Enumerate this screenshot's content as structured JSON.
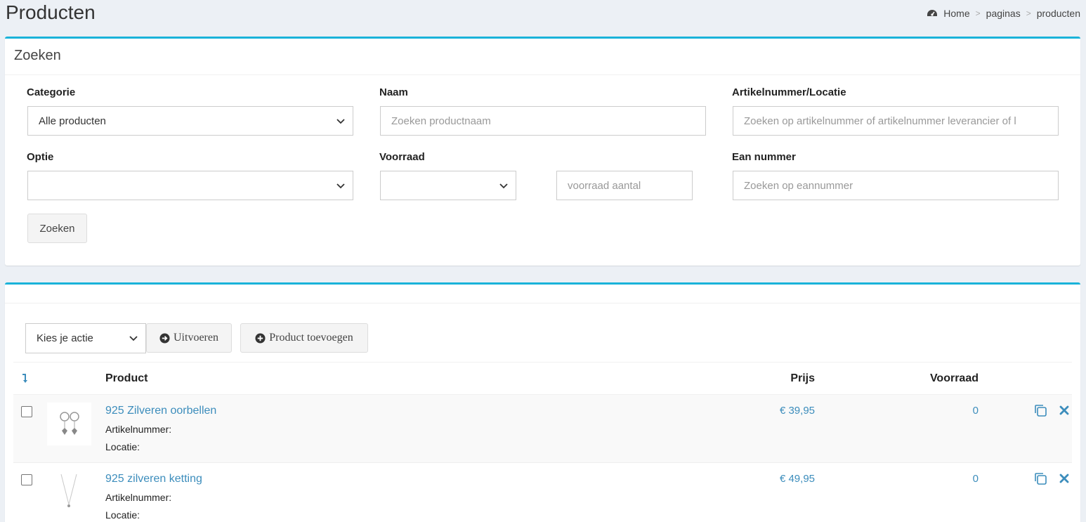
{
  "header": {
    "title": "Producten",
    "breadcrumb": [
      "Home",
      "paginas",
      "producten"
    ]
  },
  "search": {
    "title": "Zoeken",
    "categorie_label": "Categorie",
    "categorie_value": "Alle producten",
    "naam_label": "Naam",
    "naam_placeholder": "Zoeken productnaam",
    "artikel_label": "Artikelnummer/Locatie",
    "artikel_placeholder": "Zoeken op artikelnummer of artikelnummer leverancier of l",
    "optie_label": "Optie",
    "voorraad_label": "Voorraad",
    "voorraad_aantal_placeholder": "voorraad aantal",
    "ean_label": "Ean nummer",
    "ean_placeholder": "Zoeken op eannummer",
    "submit_label": "Zoeken"
  },
  "list": {
    "action_select": "Kies je actie",
    "execute_label": "Uitvoeren",
    "add_label": "Product toevoegen",
    "columns": {
      "product": "Product",
      "prijs": "Prijs",
      "voorraad": "Voorraad"
    },
    "rows": [
      {
        "name": "925 Zilveren oorbellen",
        "artikel": "Artikelnummer:",
        "locatie": "Locatie:",
        "price": "€ 39,95",
        "stock": "0"
      },
      {
        "name": "925 zilveren ketting",
        "artikel": "Artikelnummer:",
        "locatie": "Locatie:",
        "price": "€ 49,95",
        "stock": "0"
      }
    ]
  },
  "colors": {
    "accent": "#1ab3d9",
    "link": "#3c8dbc",
    "background": "#ecf0f5"
  },
  "icons": [
    "dashboard-icon",
    "chevron-down-icon",
    "arrow-circle-right-icon",
    "plus-circle-icon",
    "sort-icon",
    "copy-icon",
    "close-icon"
  ]
}
